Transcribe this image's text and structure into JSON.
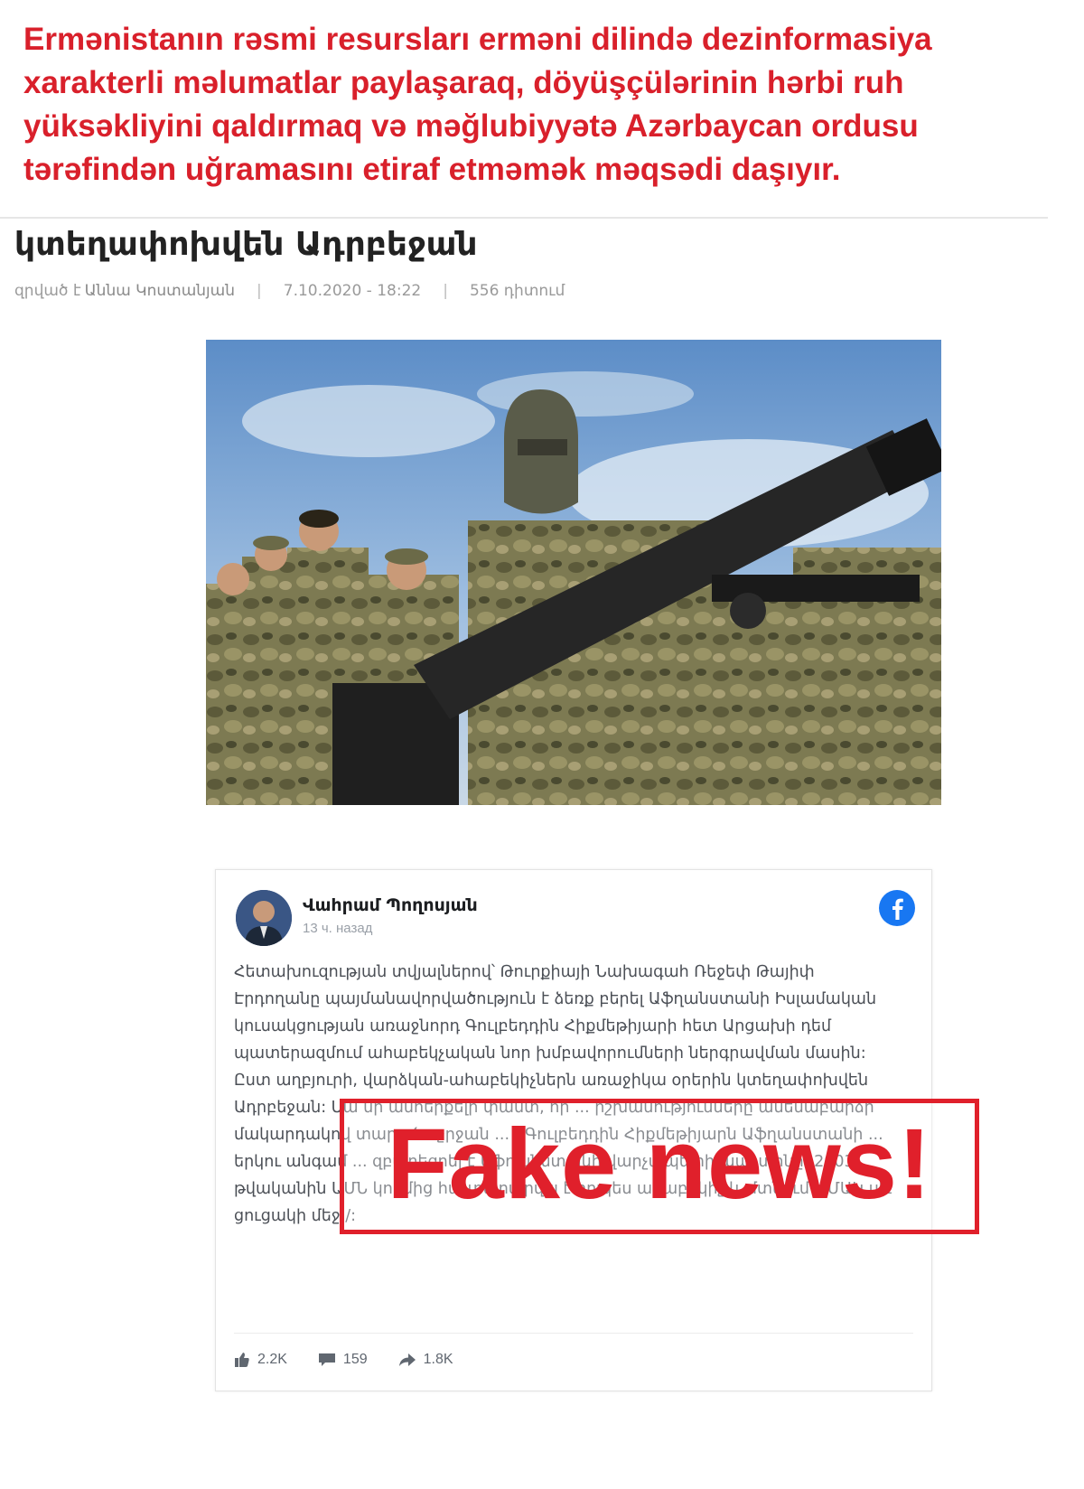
{
  "headline": "Ermənistanın rəsmi resursları erməni dilində dezinformasiya xarakterli məlumatlar paylaşaraq, döyüşçülərinin hərbi ruh yüksəkliyini qaldırmaq və məğlubiyyətə Azərbaycan ordusu tərəfindən uğramasını etiraf etməmək məqsədi daşıyır.",
  "article": {
    "title": "կտեղափոխվեն Ադրբեջան",
    "author_prefix": "զրված է",
    "author": "Աննա Կոստանյան",
    "date": "7.10.2020 - 18:22",
    "views": "556 դիտում"
  },
  "hero_image": {
    "subject": "armed soldiers in camouflage, masked fighter with rifle"
  },
  "facebook_post": {
    "name": "Վահրամ Պողոսյան",
    "time": "13 ч. назад",
    "body": "Հետախուզության տվյալներով՝ Թուրքիայի Նախագահ Ռեջեփ Թայիփ Էրդողանը պայմանավորվածություն է ձեռք բերել Աֆղանստանի Իսլամական կուսակցության առաջնորդ Գուլբեդդին Հիքմեթիյարի հետ Արցախի դեմ պատերազմում ահաբեկչական նոր խմբավորումների ներգրավման մասին: Ըստ աղբյուրի, վարձկան-ահաբեկիչներն առաջիկա օրերին կտեղափոխվեն Ադրբեջան: Սա մի անհերքելի փաստ, որ ... իշխանությունները ամենաբարձր մակարդակով տարածաշրջան ... / Գուլբեդդին Հիքմեթիյարն Աֆղանստանի ... երկու անգամ ... զբաղեցրել է Աֆղանստանի վարչապետի պաշտոնը: 2003 թվականին ԱՄՆ կողմից հայտարարվել է որպես ահաբեկիչ և մտնում է ՄԱԿ սև ցուցակի մեջ /:",
    "likes": "2.2K",
    "comments": "159",
    "shares": "1.8K"
  },
  "stamp": {
    "text": "Fake news!"
  },
  "colors": {
    "headline_red": "#d9202b",
    "stamp_red": "#e0202b",
    "facebook_blue": "#1877f2"
  },
  "icons": [
    "facebook-icon",
    "like-icon",
    "comment-icon",
    "share-icon"
  ]
}
